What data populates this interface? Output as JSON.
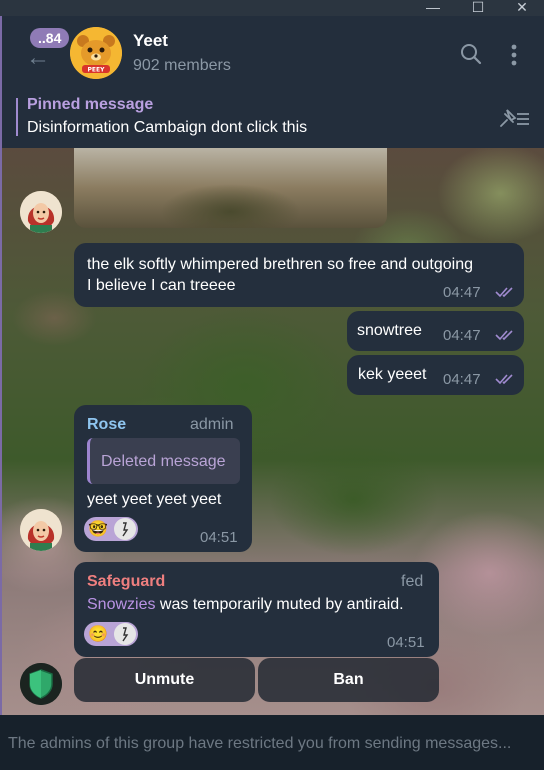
{
  "window": {
    "minimize": "—",
    "maximize": "☐",
    "close": "✕"
  },
  "header": {
    "unread_badge": "..84",
    "title": "Yeet",
    "members": "902 members",
    "avatar_caption": "PEEY"
  },
  "pinned": {
    "title": "Pinned message",
    "text": "Disinformation Cambaign  dont click this"
  },
  "messages": [
    {
      "text_line1": "the elk softly whimpered brethren so free and outgoing",
      "text_line2": "I believe I can treeee",
      "time": "04:47"
    },
    {
      "text": "snowtree",
      "time": "04:47"
    },
    {
      "text": "kek yeeet",
      "time": "04:47"
    }
  ],
  "rose_message": {
    "sender": "Rose",
    "role": "admin",
    "reply_text": "Deleted message",
    "text": "yeet yeet yeet yeet",
    "time": "04:51",
    "sender_color": "#8fc5ef"
  },
  "safeguard_message": {
    "sender": "Safeguard",
    "role": "fed",
    "user": "Snowzies",
    "text": " was temporarily muted by antiraid.",
    "time": "04:51",
    "sender_color": "#ee7f7f",
    "user_color": "#b993e4"
  },
  "inline_buttons": {
    "unmute": "Unmute",
    "ban": "Ban"
  },
  "footer": {
    "restricted_text": "The admins of this group have restricted you from sending messages..."
  }
}
